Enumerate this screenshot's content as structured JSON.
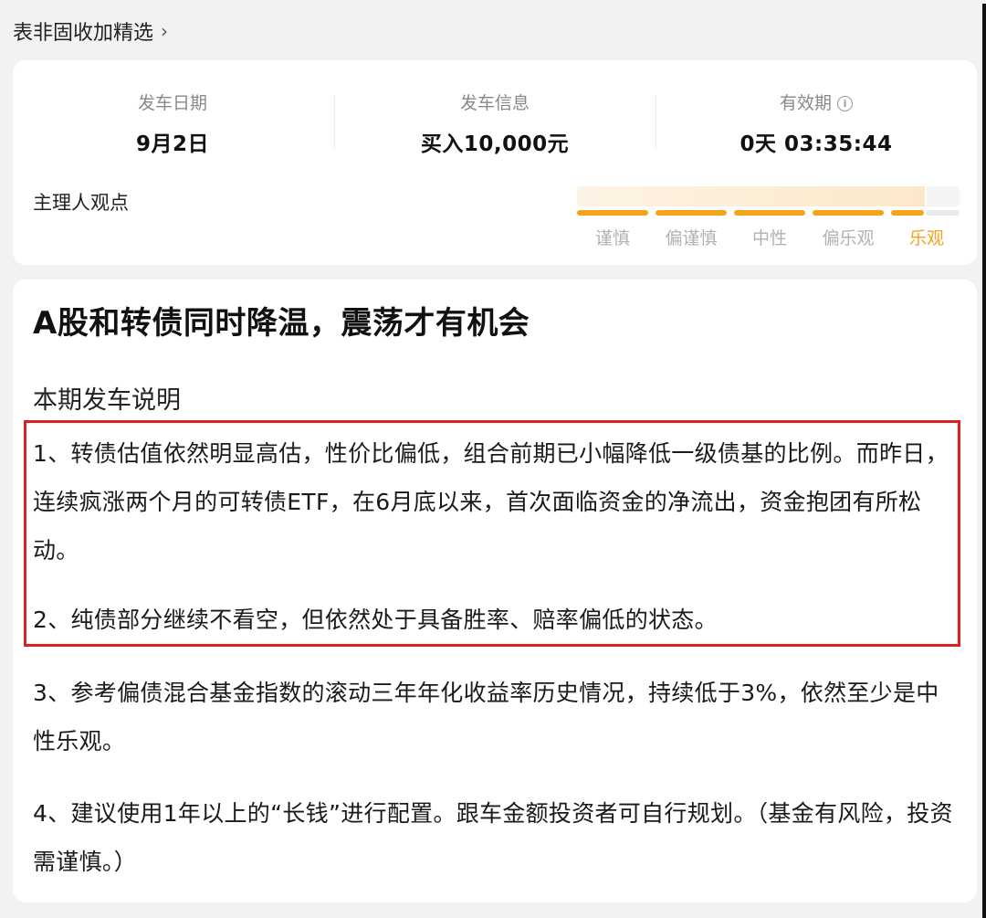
{
  "header": {
    "title": "表非固收加精选",
    "chevron": "›"
  },
  "stats": {
    "date": {
      "label": "发车日期",
      "value": "9月2日"
    },
    "info": {
      "label": "发车信息",
      "value": "买入10,000元"
    },
    "validity": {
      "label": "有效期",
      "value": "0天 03:35:44",
      "icon": "info-icon"
    }
  },
  "opinion": {
    "label": "主理人观点",
    "levels": [
      "谨慎",
      "偏谨慎",
      "中性",
      "偏乐观",
      "乐观"
    ],
    "selected_index": 4,
    "selected_label": "乐观",
    "gauge_fraction": 0.91,
    "colors": {
      "active": "#f4a31b",
      "inactive_text": "#b2b2b2"
    }
  },
  "article": {
    "title": "A股和转债同时降温，震荡才有机会",
    "section_title": "本期发车说明",
    "paragraphs": [
      "1、转债估值依然明显高估，性价比偏低，组合前期已小幅降低一级债基的比例。而昨日，连续疯涨两个月的可转债ETF，在6月底以来，首次面临资金的净流出，资金抱团有所松动。",
      "2、纯债部分继续不看空，但依然处于具备胜率、赔率偏低的状态。",
      "3、参考偏债混合基金指数的滚动三年年化收益率历史情况，持续低于3%，依然至少是中性乐观。",
      "4、建议使用1年以上的“长钱”进行配置。跟车金额投资者可自行规划。（基金有风险，投资需谨慎。）"
    ],
    "highlight_color": "#e02020"
  }
}
